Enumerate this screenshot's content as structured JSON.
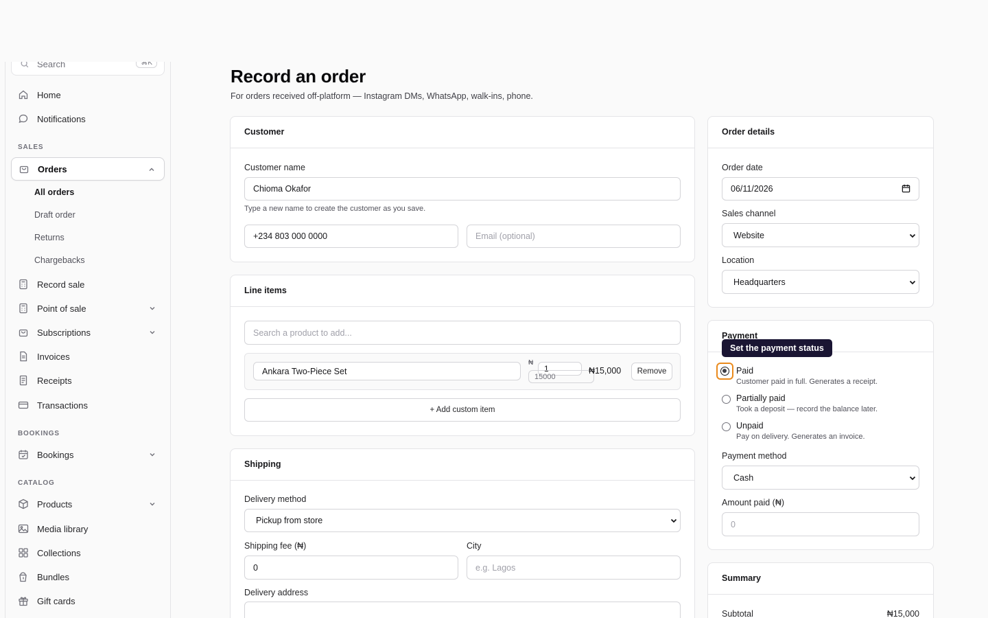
{
  "sidebar": {
    "search": {
      "placeholder": "Search",
      "shortcut": "⌘K"
    },
    "items_top": [
      {
        "label": "Home",
        "icon": "home-icon"
      },
      {
        "label": "Notifications",
        "icon": "chat-bubble-icon"
      }
    ],
    "section_sales": "SALES",
    "orders": {
      "label": "Orders",
      "icon": "shopping-bag-icon",
      "expanded": true
    },
    "orders_sub": [
      "All orders",
      "Draft order",
      "Returns",
      "Chargebacks"
    ],
    "sales_items": [
      {
        "label": "Record sale",
        "icon": "calculator-icon",
        "has_chevron": false
      },
      {
        "label": "Point of sale",
        "icon": "calculator-icon",
        "has_chevron": true
      },
      {
        "label": "Subscriptions",
        "icon": "shopping-bag-icon",
        "has_chevron": true
      },
      {
        "label": "Invoices",
        "icon": "document-icon",
        "has_chevron": false
      },
      {
        "label": "Receipts",
        "icon": "receipt-icon",
        "has_chevron": false
      },
      {
        "label": "Transactions",
        "icon": "credit-card-icon",
        "has_chevron": false
      }
    ],
    "section_bookings": "BOOKINGS",
    "bookings": {
      "label": "Bookings",
      "icon": "calendar-icon"
    },
    "section_catalog": "CATALOG",
    "catalog_items": [
      {
        "label": "Products",
        "icon": "box-icon",
        "has_chevron": true
      },
      {
        "label": "Media library",
        "icon": "image-icon",
        "has_chevron": false
      },
      {
        "label": "Collections",
        "icon": "grid-icon",
        "has_chevron": false
      },
      {
        "label": "Bundles",
        "icon": "bundle-icon",
        "has_chevron": false
      },
      {
        "label": "Gift cards",
        "icon": "gift-icon",
        "has_chevron": false
      }
    ]
  },
  "page": {
    "title": "Record an order",
    "subtitle": "For orders received off-platform — Instagram DMs, WhatsApp, walk-ins, phone."
  },
  "customer": {
    "heading": "Customer",
    "name_label": "Customer name",
    "name_value": "Chioma Okafor",
    "name_hint": "Type a new name to create the customer as you save.",
    "phone_value": "+234 803 000 0000",
    "email_placeholder": "Email (optional)"
  },
  "line_items": {
    "heading": "Line items",
    "search_placeholder": "Search a product to add...",
    "items": [
      {
        "name": "Ankara Two-Piece Set",
        "currency_symbol": "₦",
        "qty": "1",
        "unit_price": "15000",
        "total": "₦15,000",
        "remove_label": "Remove"
      }
    ],
    "add_custom_label": "+ Add custom item"
  },
  "shipping": {
    "heading": "Shipping",
    "delivery_method_label": "Delivery method",
    "delivery_method_value": "Pickup from store",
    "fee_label": "Shipping fee (₦)",
    "fee_value": "0",
    "city_label": "City",
    "city_placeholder": "e.g. Lagos",
    "address_label": "Delivery address"
  },
  "order_details": {
    "heading": "Order details",
    "date_label": "Order date",
    "date_value": "06/11/2026",
    "channel_label": "Sales channel",
    "channel_value": "Website",
    "location_label": "Location",
    "location_value": "Headquarters"
  },
  "payment": {
    "heading": "Payment",
    "tooltip": "Set the payment status",
    "options": [
      {
        "title": "Paid",
        "desc": "Customer paid in full. Generates a receipt.",
        "checked": true
      },
      {
        "title": "Partially paid",
        "desc": "Took a deposit — record the balance later.",
        "checked": false
      },
      {
        "title": "Unpaid",
        "desc": "Pay on delivery. Generates an invoice.",
        "checked": false
      }
    ],
    "method_label": "Payment method",
    "method_value": "Cash",
    "amount_label": "Amount paid (₦)",
    "amount_placeholder": "0"
  },
  "summary": {
    "heading": "Summary",
    "subtotal_label": "Subtotal",
    "subtotal_value": "₦15,000"
  },
  "colors": {
    "focus_ring": "#ea8a1c",
    "tooltip_bg": "#1a1533"
  }
}
